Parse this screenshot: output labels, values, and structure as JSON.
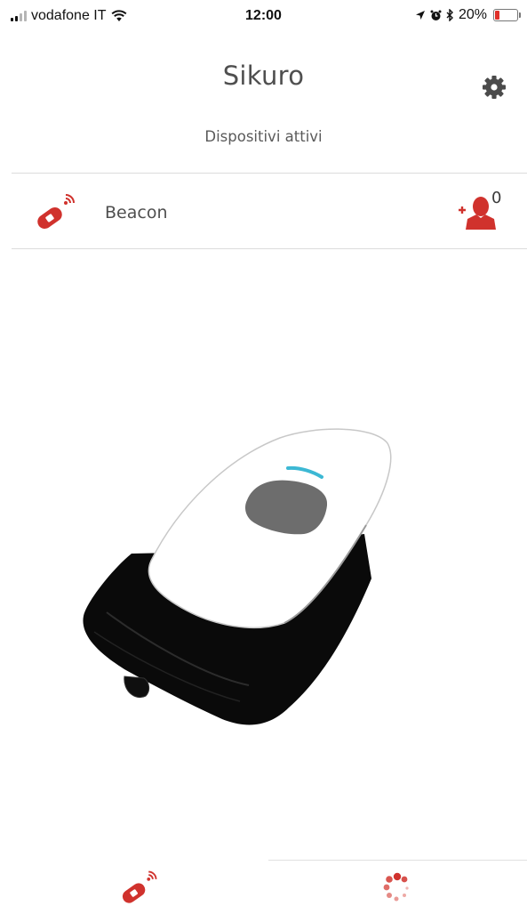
{
  "status_bar": {
    "carrier": "vodafone IT",
    "time": "12:00",
    "battery_percent_label": "20%",
    "battery_level": 0.2,
    "icons": [
      "signal-icon",
      "wifi-icon",
      "location-arrow-icon",
      "alarm-icon",
      "bluetooth-icon",
      "battery-icon"
    ]
  },
  "header": {
    "title": "Sikuro",
    "subtitle": "Dispositivi attivi",
    "settings_icon": "gear-icon"
  },
  "device_list": [
    {
      "icon": "beacon-icon",
      "name": "Beacon",
      "add_user_icon": "add-user-icon",
      "user_count": "0"
    }
  ],
  "illustration": {
    "subject": "beacon-device-image"
  },
  "tab_bar": {
    "tabs": [
      {
        "icon": "beacon-tab-icon",
        "active": true
      },
      {
        "icon": "loading-spinner-icon",
        "active": false
      }
    ]
  },
  "colors": {
    "accent": "#d0322d",
    "accent_light": "#e58a85",
    "text": "#4f4f4f",
    "divider": "#dcdcdc",
    "led": "#3cb8d4"
  }
}
